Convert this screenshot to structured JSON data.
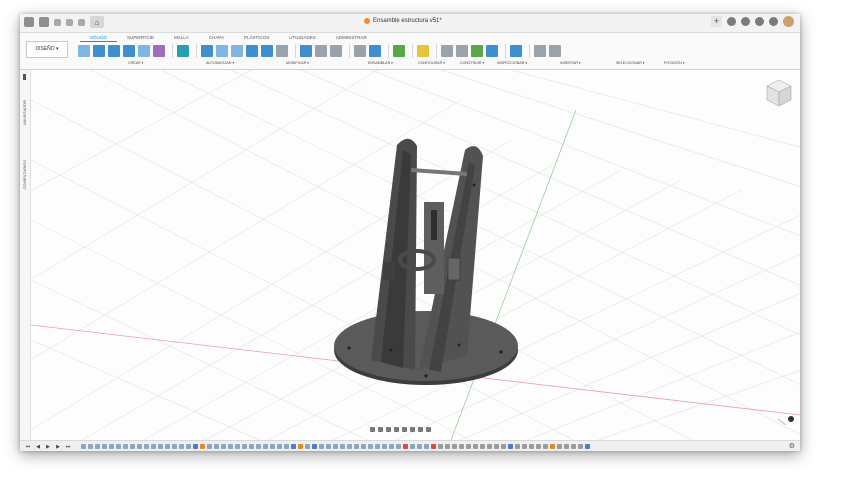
{
  "titlebar": {
    "document_title": "Ensamble estructura v51*",
    "home_label": "⌂"
  },
  "ribbon": {
    "workspace": "DISEÑO ▾",
    "tabs": [
      "SÓLIDO",
      "SUPERFICIE",
      "MALLA",
      "CHAPA",
      "PLÁSTICOS",
      "UTILIDADES",
      "ADMINISTRAR"
    ],
    "active_tab": "SÓLIDO",
    "groups": [
      "CREAR ▾",
      "AUTOMATIZAR ▾",
      "MODIFICAR ▾",
      "ENSAMBLAR ▾",
      "CONFIGURAR ▾",
      "CONSTRUIR ▾",
      "INSPECCIONAR ▾",
      "INSERTAR ▾",
      "SELECCIONAR ▾",
      "POSICIÓN ▾"
    ]
  },
  "side_panel": {
    "navigator": "NAVEGADOR",
    "comments": "COMENTARIOS"
  },
  "colors": {
    "accent": "#0696d7",
    "grid": "#d9d9d9",
    "axis_red": "#e35d5d",
    "axis_green": "#5db85d",
    "part": "#4e4e4e"
  },
  "timeline": {
    "controls": [
      "⏮",
      "◀",
      "▶",
      "▶",
      "⏭"
    ]
  }
}
